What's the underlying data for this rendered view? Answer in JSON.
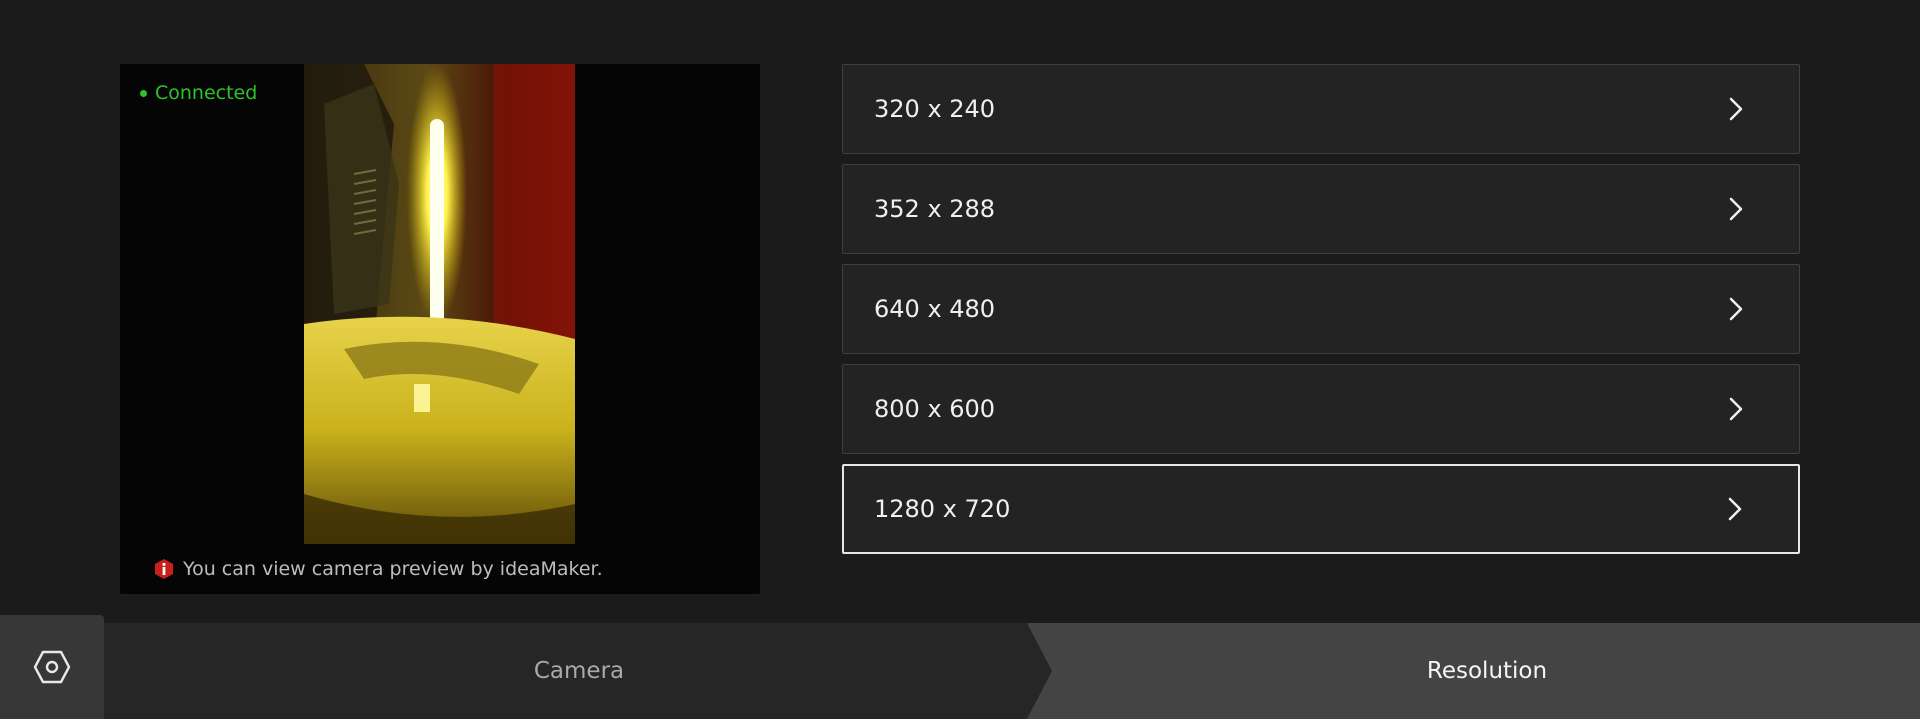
{
  "preview": {
    "status_text": "Connected",
    "status_color": "#2fc22a",
    "notice_text": "You can view camera preview by ideaMaker.",
    "notice_icon": "info-warning-icon"
  },
  "resolutions": [
    {
      "label": "320 x 240",
      "selected": false
    },
    {
      "label": "352 x 288",
      "selected": false
    },
    {
      "label": "640 x 480",
      "selected": false
    },
    {
      "label": "800 x 600",
      "selected": false
    },
    {
      "label": "1280 x 720",
      "selected": true
    }
  ],
  "bottom_bar": {
    "settings_icon": "hexagon-settings-icon",
    "breadcrumbs": [
      {
        "label": "Camera",
        "active": false
      },
      {
        "label": "Resolution",
        "active": true
      }
    ]
  }
}
